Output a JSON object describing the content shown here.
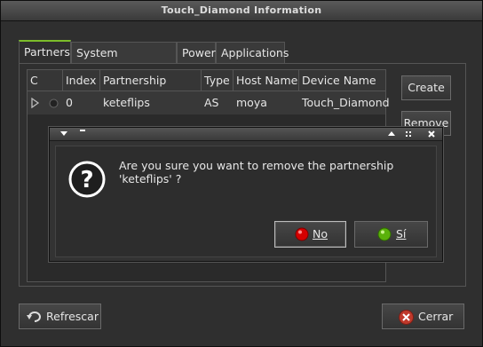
{
  "window": {
    "title": "Touch_Diamond Information"
  },
  "tabs": [
    "Partners",
    "System Information",
    "Power",
    "Applications"
  ],
  "table": {
    "headers": [
      "C",
      "Index",
      "Partnership Name",
      "Type",
      "Host Name",
      "Device Name"
    ],
    "rows": [
      {
        "index": "0",
        "name": "keteflips",
        "type": "AS",
        "host": "moya",
        "device": "Touch_Diamond"
      }
    ]
  },
  "side_buttons": {
    "create": "Create",
    "remove": "Remove"
  },
  "footer": {
    "refresh": "Refrescar",
    "close": "Cerrar"
  },
  "dialog": {
    "message": "Are you sure you want to remove the partnership 'keteflips' ?",
    "no": "No",
    "yes": "Sí",
    "icon": "question-icon"
  },
  "colors": {
    "accent": "#7cbd2a",
    "no_icon": "#d40000",
    "yes_icon": "#5ab10a",
    "close_icon": "#c0392b"
  }
}
